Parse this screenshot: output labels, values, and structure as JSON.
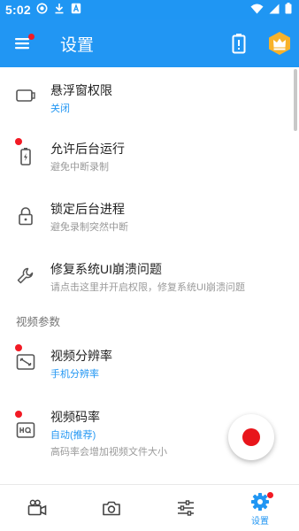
{
  "status_bar": {
    "time": "5:02",
    "icons": [
      "screen-record-icon",
      "download-icon",
      "notification-a-icon",
      "wifi-icon",
      "cell-signal-icon",
      "battery-icon"
    ]
  },
  "app_bar": {
    "title": "设置",
    "icons": [
      "menu-icon",
      "battery-optimization-icon",
      "vip-crown-icon"
    ],
    "has_menu_badge": true
  },
  "settings": [
    {
      "title": "悬浮窗权限",
      "subtitle": "关闭",
      "subtitle_style": "accent",
      "icon": "floating-window-icon",
      "badge": false
    },
    {
      "title": "允许后台运行",
      "subtitle": "避免中断录制",
      "subtitle_style": "muted",
      "icon": "battery-icon",
      "badge": true
    },
    {
      "title": "锁定后台进程",
      "subtitle": "避免录制突然中断",
      "subtitle_style": "muted",
      "icon": "lock-icon",
      "badge": false
    },
    {
      "title": "修复系统UI崩溃问题",
      "subtitle": "请点击这里并开启权限，修复系统UI崩溃问题",
      "subtitle_style": "muted",
      "icon": "wrench-icon",
      "badge": false
    }
  ],
  "section_video": {
    "heading": "视频参数",
    "items": [
      {
        "title": "视频分辨率",
        "subtitle": "手机分辨率",
        "subtitle_style": "accent",
        "icon": "resolution-icon",
        "badge": true
      },
      {
        "title": "视频码率",
        "subtitle": "自动(推荐)",
        "subtitle_style": "accent",
        "note": "高码率会增加视频文件大小",
        "icon": "hq-icon",
        "badge": true
      }
    ]
  },
  "bottom_nav": {
    "items": [
      {
        "icon": "video-camera-icon",
        "label": ""
      },
      {
        "icon": "camera-icon",
        "label": ""
      },
      {
        "icon": "sliders-icon",
        "label": ""
      },
      {
        "icon": "settings-gear-icon",
        "label": "设置",
        "active": true,
        "badge": true
      }
    ]
  },
  "colors": {
    "primary": "#2196f3",
    "status_bar": "#1f96f3",
    "badge": "#f21a24",
    "record": "#e8151b",
    "crown_bg": "#f7b22a"
  }
}
